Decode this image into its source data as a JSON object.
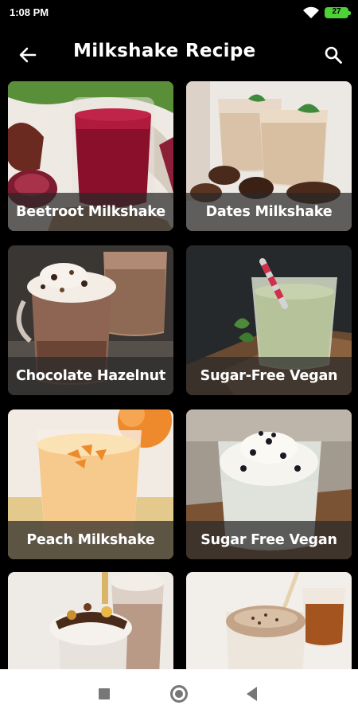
{
  "status_bar": {
    "time": "1:08 PM",
    "battery": "27"
  },
  "app_bar": {
    "title": "Milkshake Recipe",
    "back_icon": "arrow-left-icon",
    "search_icon": "search-icon"
  },
  "recipes": [
    {
      "label": "Beetroot Milkshake"
    },
    {
      "label": "Dates Milkshake"
    },
    {
      "label": "Chocolate Hazelnut"
    },
    {
      "label": "Sugar-Free Vegan"
    },
    {
      "label": "Peach Milkshake"
    },
    {
      "label": "Sugar Free Vegan"
    },
    {
      "label": ""
    },
    {
      "label": ""
    }
  ],
  "nav_bar": {
    "recent_icon": "square-icon",
    "home_icon": "circle-icon",
    "back_icon": "triangle-back-icon"
  },
  "colors": {
    "background": "#000000",
    "battery": "#4cd137",
    "label_overlay": "#282828"
  }
}
